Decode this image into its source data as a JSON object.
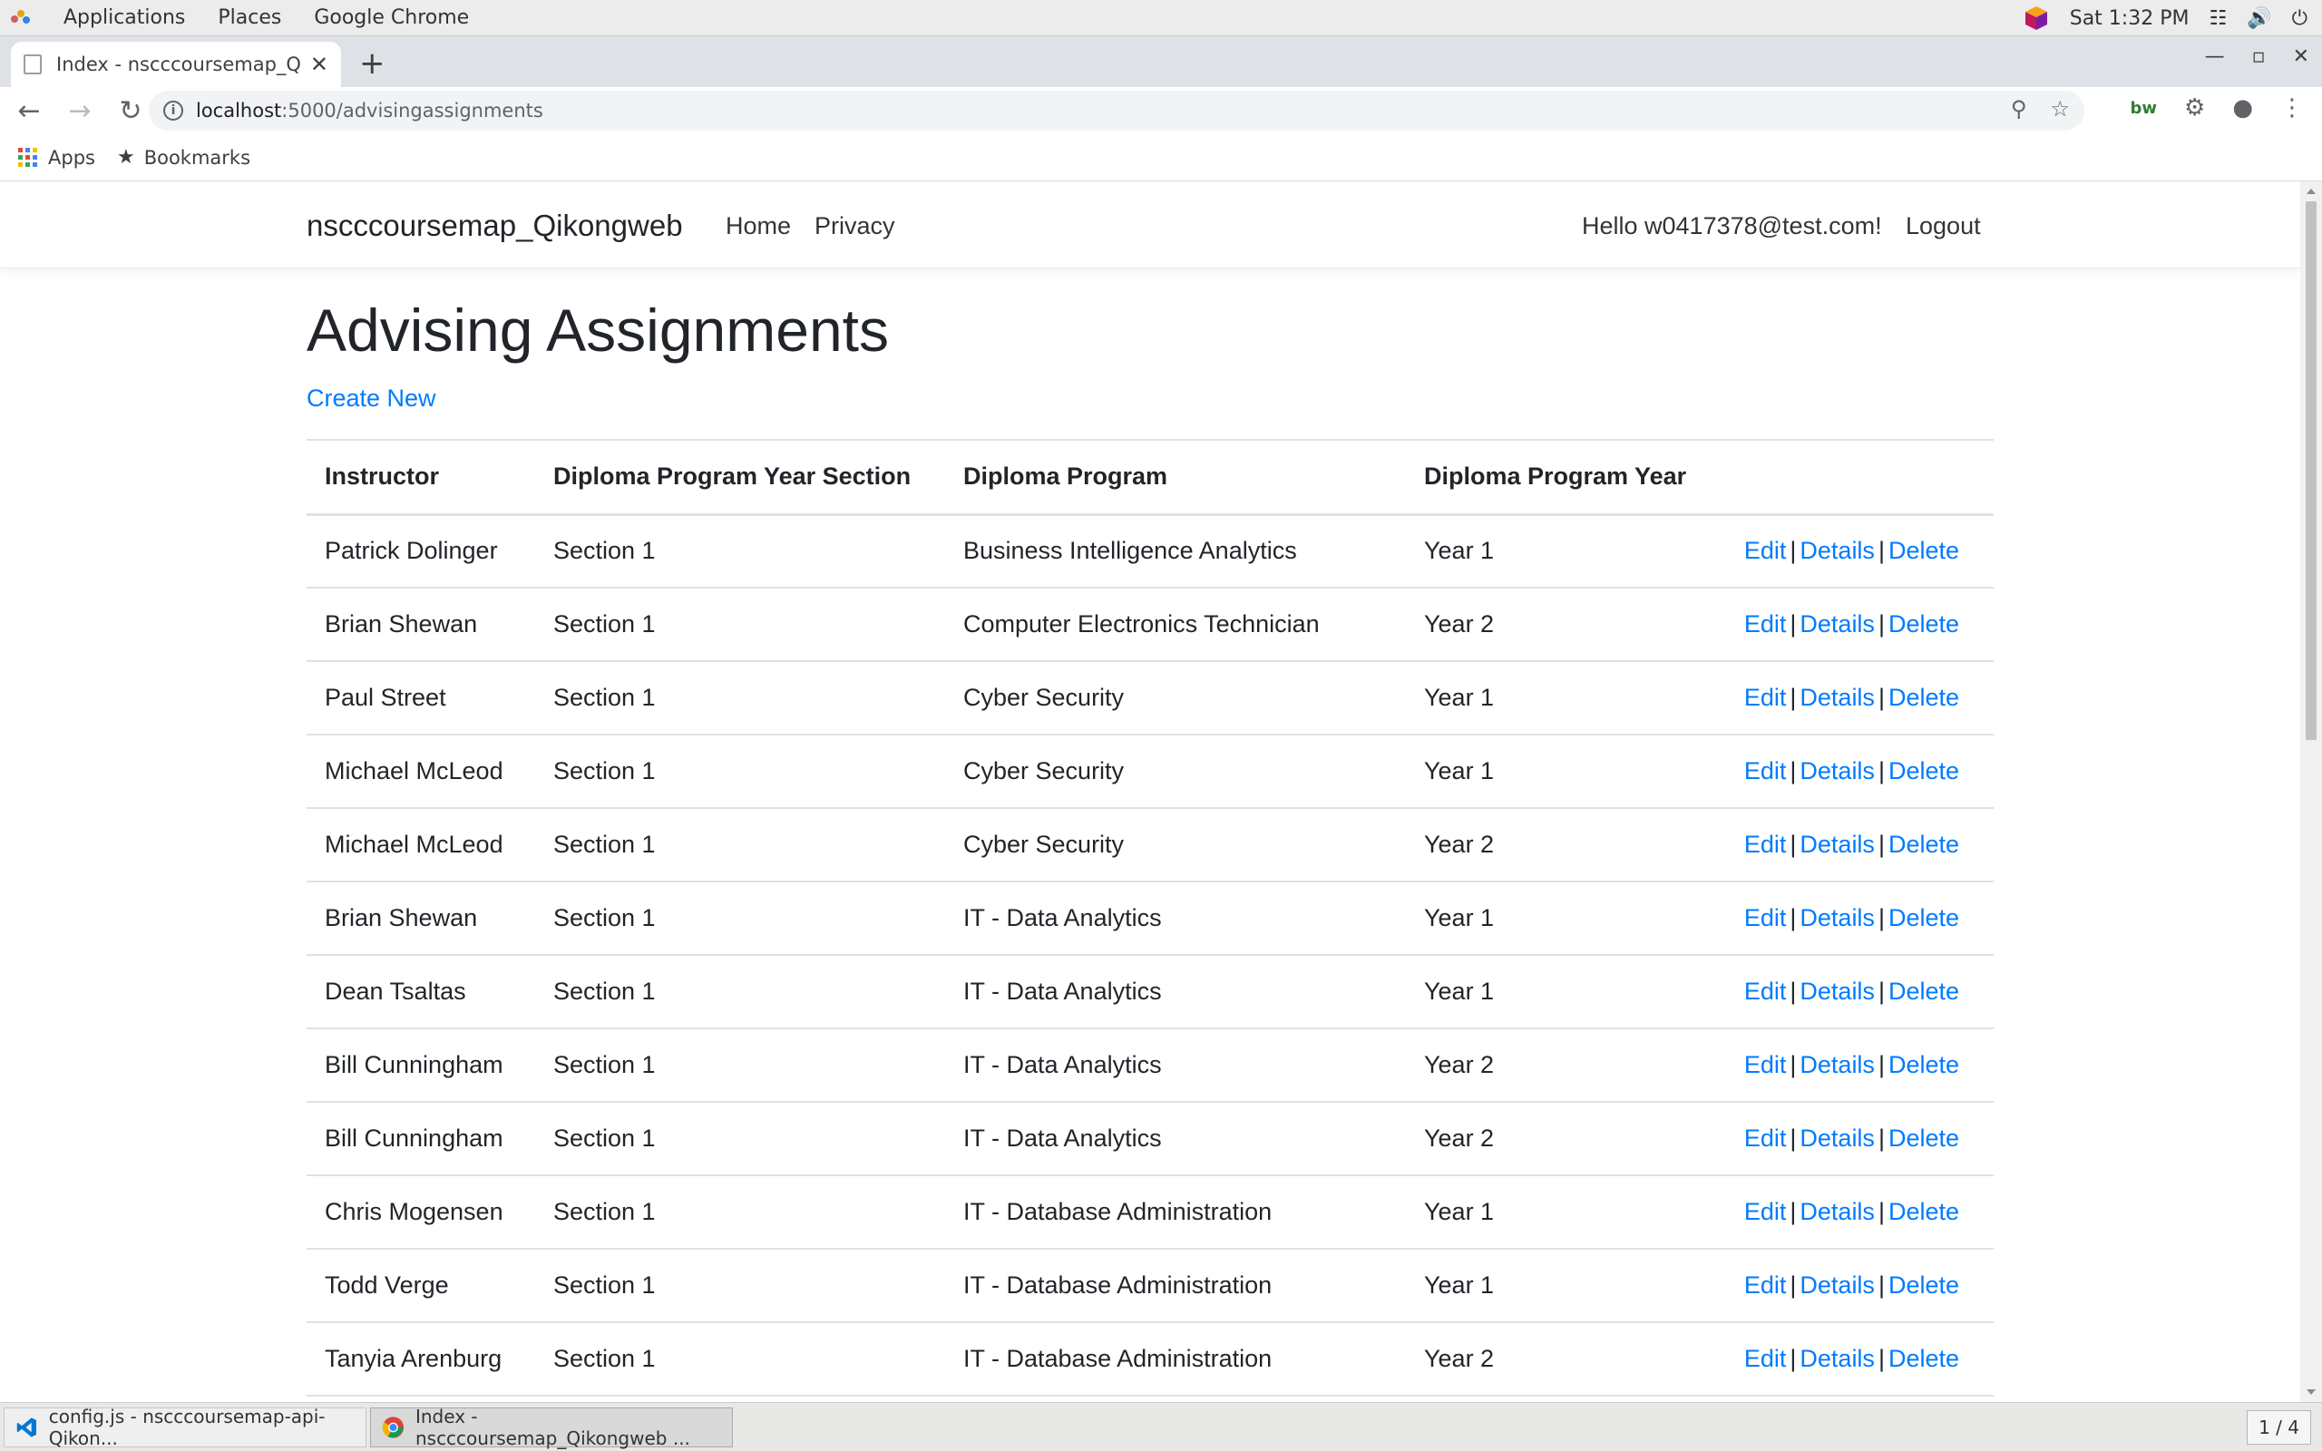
{
  "desktop": {
    "menu": [
      "Applications",
      "Places",
      "Google Chrome"
    ],
    "clock": "Sat  1:32 PM"
  },
  "browser": {
    "tab_title": "Index - nscccoursemap_Qikongweb",
    "url_host": "localhost",
    "url_path": ":5000/advisingassignments",
    "bookmarks": {
      "apps": "Apps",
      "bookmarks": "Bookmarks"
    }
  },
  "site": {
    "brand": "nscccoursemap_Qikongweb",
    "nav": {
      "home": "Home",
      "privacy": "Privacy"
    },
    "greeting": "Hello w0417378@test.com!",
    "logout": "Logout"
  },
  "page": {
    "title": "Advising Assignments",
    "create_new": "Create New"
  },
  "table": {
    "headers": [
      "Instructor",
      "Diploma Program Year Section",
      "Diploma Program",
      "Diploma Program Year"
    ],
    "action_labels": {
      "edit": "Edit",
      "details": "Details",
      "delete": "Delete",
      "sep": "|"
    },
    "rows": [
      [
        "Patrick Dolinger",
        "Section 1",
        "Business Intelligence Analytics",
        "Year 1"
      ],
      [
        "Brian Shewan",
        "Section 1",
        "Computer Electronics Technician",
        "Year 2"
      ],
      [
        "Paul Street",
        "Section 1",
        "Cyber Security",
        "Year 1"
      ],
      [
        "Michael McLeod",
        "Section 1",
        "Cyber Security",
        "Year 1"
      ],
      [
        "Michael McLeod",
        "Section 1",
        "Cyber Security",
        "Year 2"
      ],
      [
        "Brian Shewan",
        "Section 1",
        "IT - Data Analytics",
        "Year 1"
      ],
      [
        "Dean Tsaltas",
        "Section 1",
        "IT - Data Analytics",
        "Year 1"
      ],
      [
        "Bill Cunningham",
        "Section 1",
        "IT - Data Analytics",
        "Year 2"
      ],
      [
        "Bill Cunningham",
        "Section 1",
        "IT - Data Analytics",
        "Year 2"
      ],
      [
        "Chris Mogensen",
        "Section 1",
        "IT - Database Administration",
        "Year 1"
      ],
      [
        "Todd Verge",
        "Section 1",
        "IT - Database Administration",
        "Year 1"
      ],
      [
        "Tanyia Arenburg",
        "Section 1",
        "IT - Database Administration",
        "Year 2"
      ]
    ]
  },
  "taskbar": {
    "items": [
      "config.js - nscccoursemap-api-Qikon...",
      "Index - nscccoursemap_Qikongweb ..."
    ],
    "pager": "1 / 4"
  },
  "colors": {
    "link": "#007bff",
    "text": "#212529",
    "border": "#dee2e6"
  }
}
